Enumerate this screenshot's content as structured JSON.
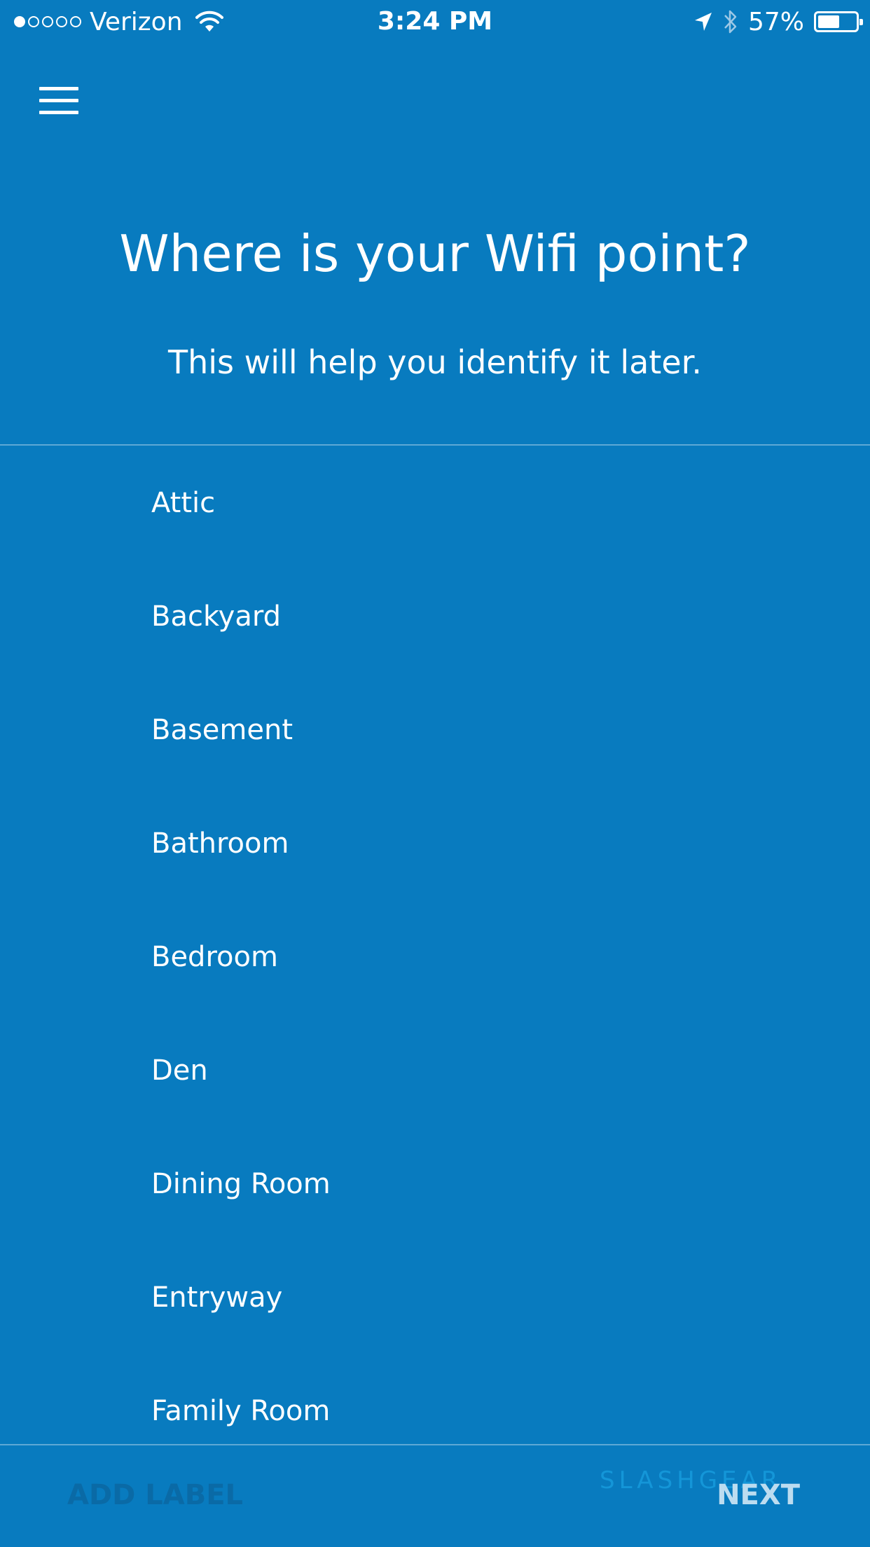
{
  "status_bar": {
    "carrier": "Verizon",
    "time": "3:24 PM",
    "battery": "57%",
    "battery_level": 0.57,
    "signal_bars_filled": 1,
    "signal_bars_total": 5,
    "icons": [
      "wifi-icon",
      "location-arrow-icon",
      "bluetooth-icon",
      "battery-icon"
    ]
  },
  "header": {
    "menu_icon": "hamburger-menu-icon",
    "title": "Where is your Wifi point?",
    "subtitle": "This will help you identify it later."
  },
  "locations": [
    {
      "label": "Attic"
    },
    {
      "label": "Backyard"
    },
    {
      "label": "Basement"
    },
    {
      "label": "Bathroom"
    },
    {
      "label": "Bedroom"
    },
    {
      "label": "Den"
    },
    {
      "label": "Dining Room"
    },
    {
      "label": "Entryway"
    },
    {
      "label": "Family Room"
    }
  ],
  "footer": {
    "add_label": "ADD LABEL",
    "next_label": "NEXT",
    "watermark": "SLASHGEAR"
  },
  "colors": {
    "background": "#087bbf",
    "text": "#ffffff",
    "disabled_text": "#0a6aa6",
    "next_text": "#bcdcf0"
  }
}
